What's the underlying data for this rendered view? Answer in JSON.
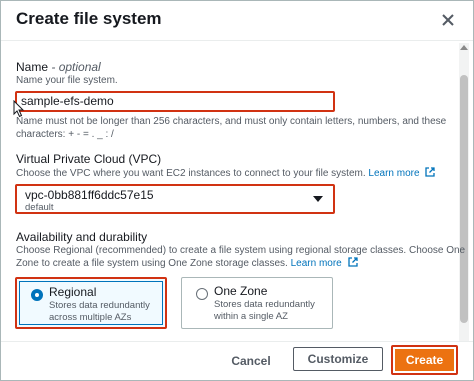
{
  "dialog": {
    "title": "Create file system"
  },
  "name_field": {
    "label": "Name",
    "optional": "optional",
    "separator": " - ",
    "description": "Name your file system.",
    "value": "sample-efs-demo",
    "constraint_line1": "Name must not be longer than 256 characters, and must only contain letters, numbers, and these",
    "constraint_line2": "characters: + - = . _ : /"
  },
  "vpc_field": {
    "label": "Virtual Private Cloud (VPC)",
    "description": "Choose the VPC where you want EC2 instances to connect to your file system.",
    "learn_more": "Learn more",
    "selected_value": "vpc-0bb881ff6ddc57e15",
    "selected_sub": "default"
  },
  "availability": {
    "label": "Availability and durability",
    "description_line1": "Choose Regional (recommended) to create a file system using regional storage classes. Choose One",
    "description_line2": "Zone to create a file system using One Zone storage classes.",
    "learn_more": "Learn more",
    "options": [
      {
        "title": "Regional",
        "desc_line1": "Stores data redundantly",
        "desc_line2": "across multiple AZs",
        "selected": true
      },
      {
        "title": "One Zone",
        "desc_line1": "Stores data redundantly",
        "desc_line2": "within a single AZ",
        "selected": false
      }
    ]
  },
  "footer": {
    "cancel": "Cancel",
    "customize": "Customize",
    "create": "Create"
  },
  "colors": {
    "accent": "#0073bb",
    "primary_button": "#ec7211",
    "highlight_border": "#d13212"
  },
  "icons": {
    "close": "close-icon",
    "external_link": "external-link-icon",
    "dropdown": "caret-down-icon",
    "cursor": "mouse-pointer-icon"
  }
}
